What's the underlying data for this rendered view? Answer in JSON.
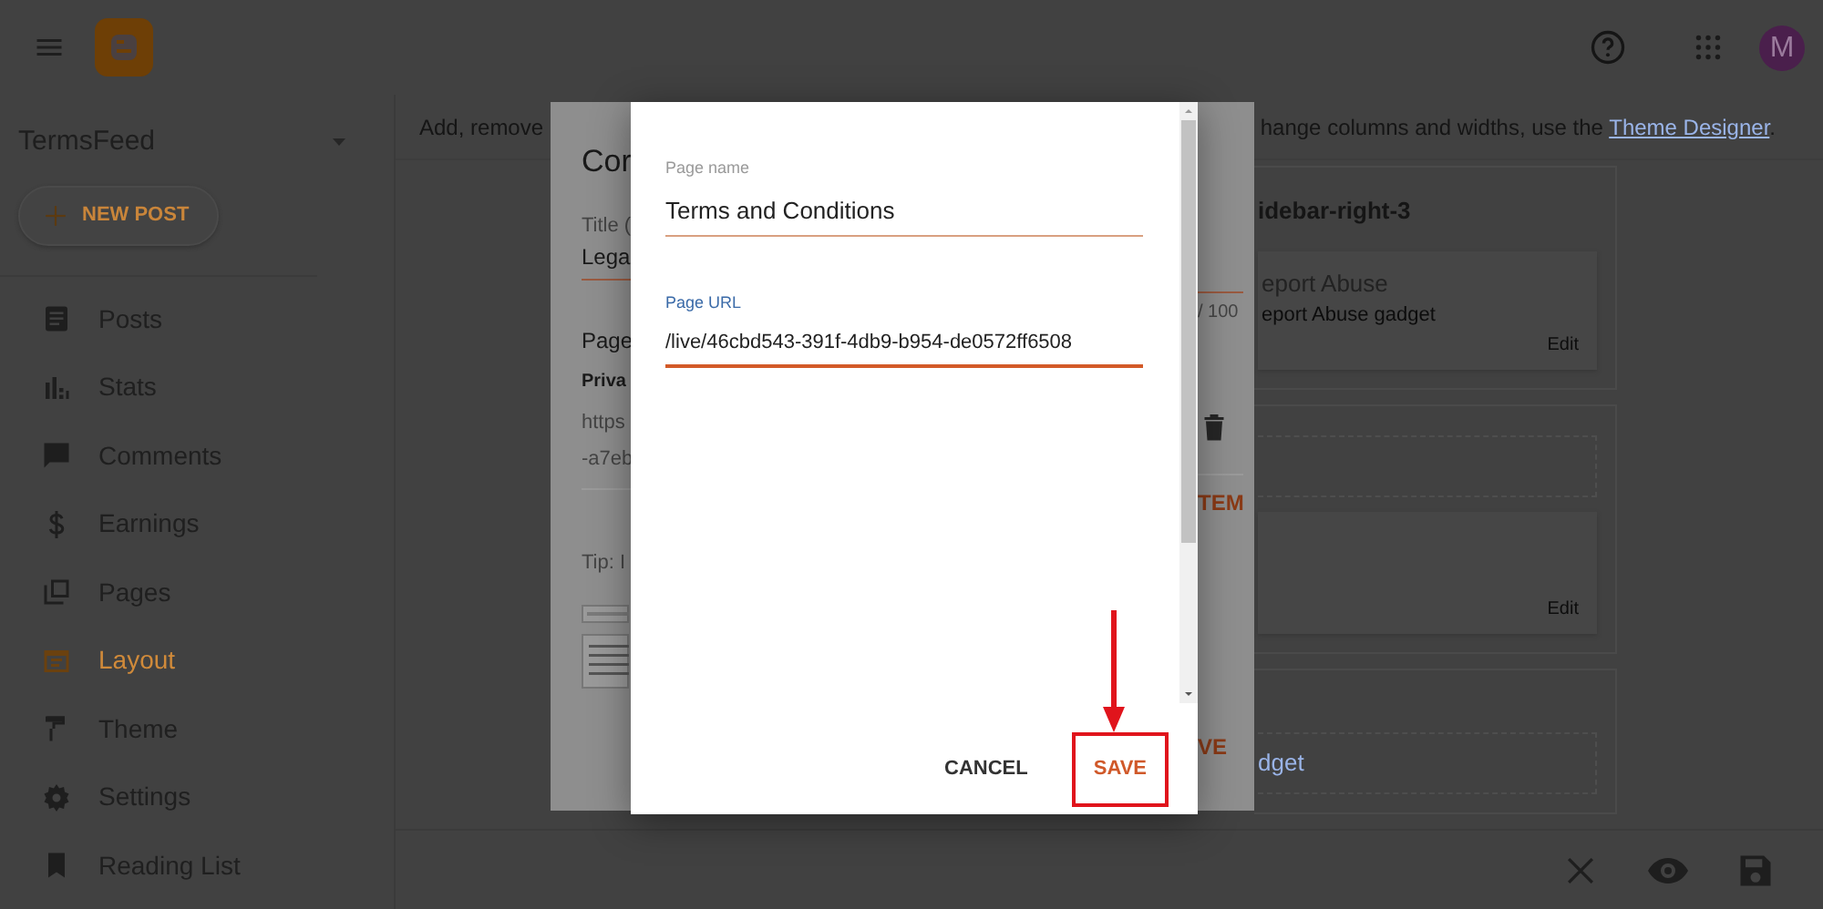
{
  "top_bar": {
    "avatar_letter": "M"
  },
  "blog_selector": {
    "name": "TermsFeed"
  },
  "new_post_button": {
    "label": "NEW POST"
  },
  "nav": [
    {
      "label": "Posts",
      "kind": "posts",
      "selected": false
    },
    {
      "label": "Stats",
      "kind": "stats",
      "selected": false
    },
    {
      "label": "Comments",
      "kind": "comments",
      "selected": false
    },
    {
      "label": "Earnings",
      "kind": "earnings",
      "selected": false
    },
    {
      "label": "Pages",
      "kind": "pages",
      "selected": false
    },
    {
      "label": "Layout",
      "kind": "layout",
      "selected": true
    },
    {
      "label": "Theme",
      "kind": "theme",
      "selected": false
    },
    {
      "label": "Settings",
      "kind": "settings",
      "selected": false
    },
    {
      "label": "Reading List",
      "kind": "reading",
      "selected": false
    }
  ],
  "layout_intro": {
    "start": "Add, remove",
    "end": "hange columns and widths, use the ",
    "link": "Theme Designer",
    "trailing": "."
  },
  "sections": [
    {
      "title": "idebar-right-3",
      "kind": "gadgets",
      "gadget": {
        "title": "eport Abuse",
        "description": "eport Abuse gadget",
        "edit": "Edit"
      }
    },
    {
      "kind": "gadgets",
      "gadget": {
        "edit": "Edit"
      }
    },
    {
      "kind": "add",
      "link": "dget"
    }
  ],
  "back_dialog": {
    "title": "Cor",
    "title_label": "Title (",
    "title_value": "Lega",
    "counter": "/ 100",
    "page_label": "Page",
    "page_name": "Priva",
    "url_start": "https",
    "url_end": "-a7eb",
    "action": "TEM",
    "tip": "Tip: I",
    "save": "VE"
  },
  "page_dialog": {
    "fields": [
      {
        "label": "Page name",
        "value": "Terms and Conditions",
        "focused": false
      },
      {
        "label": "Page URL",
        "value": "/live/46cbd543-391f-4db9-b954-de0572ff6508",
        "focused": true
      }
    ],
    "buttons": [
      {
        "label": "CANCEL",
        "kind": "plain",
        "highlighted": false
      },
      {
        "label": "SAVE",
        "kind": "primary",
        "highlighted": true
      }
    ]
  }
}
